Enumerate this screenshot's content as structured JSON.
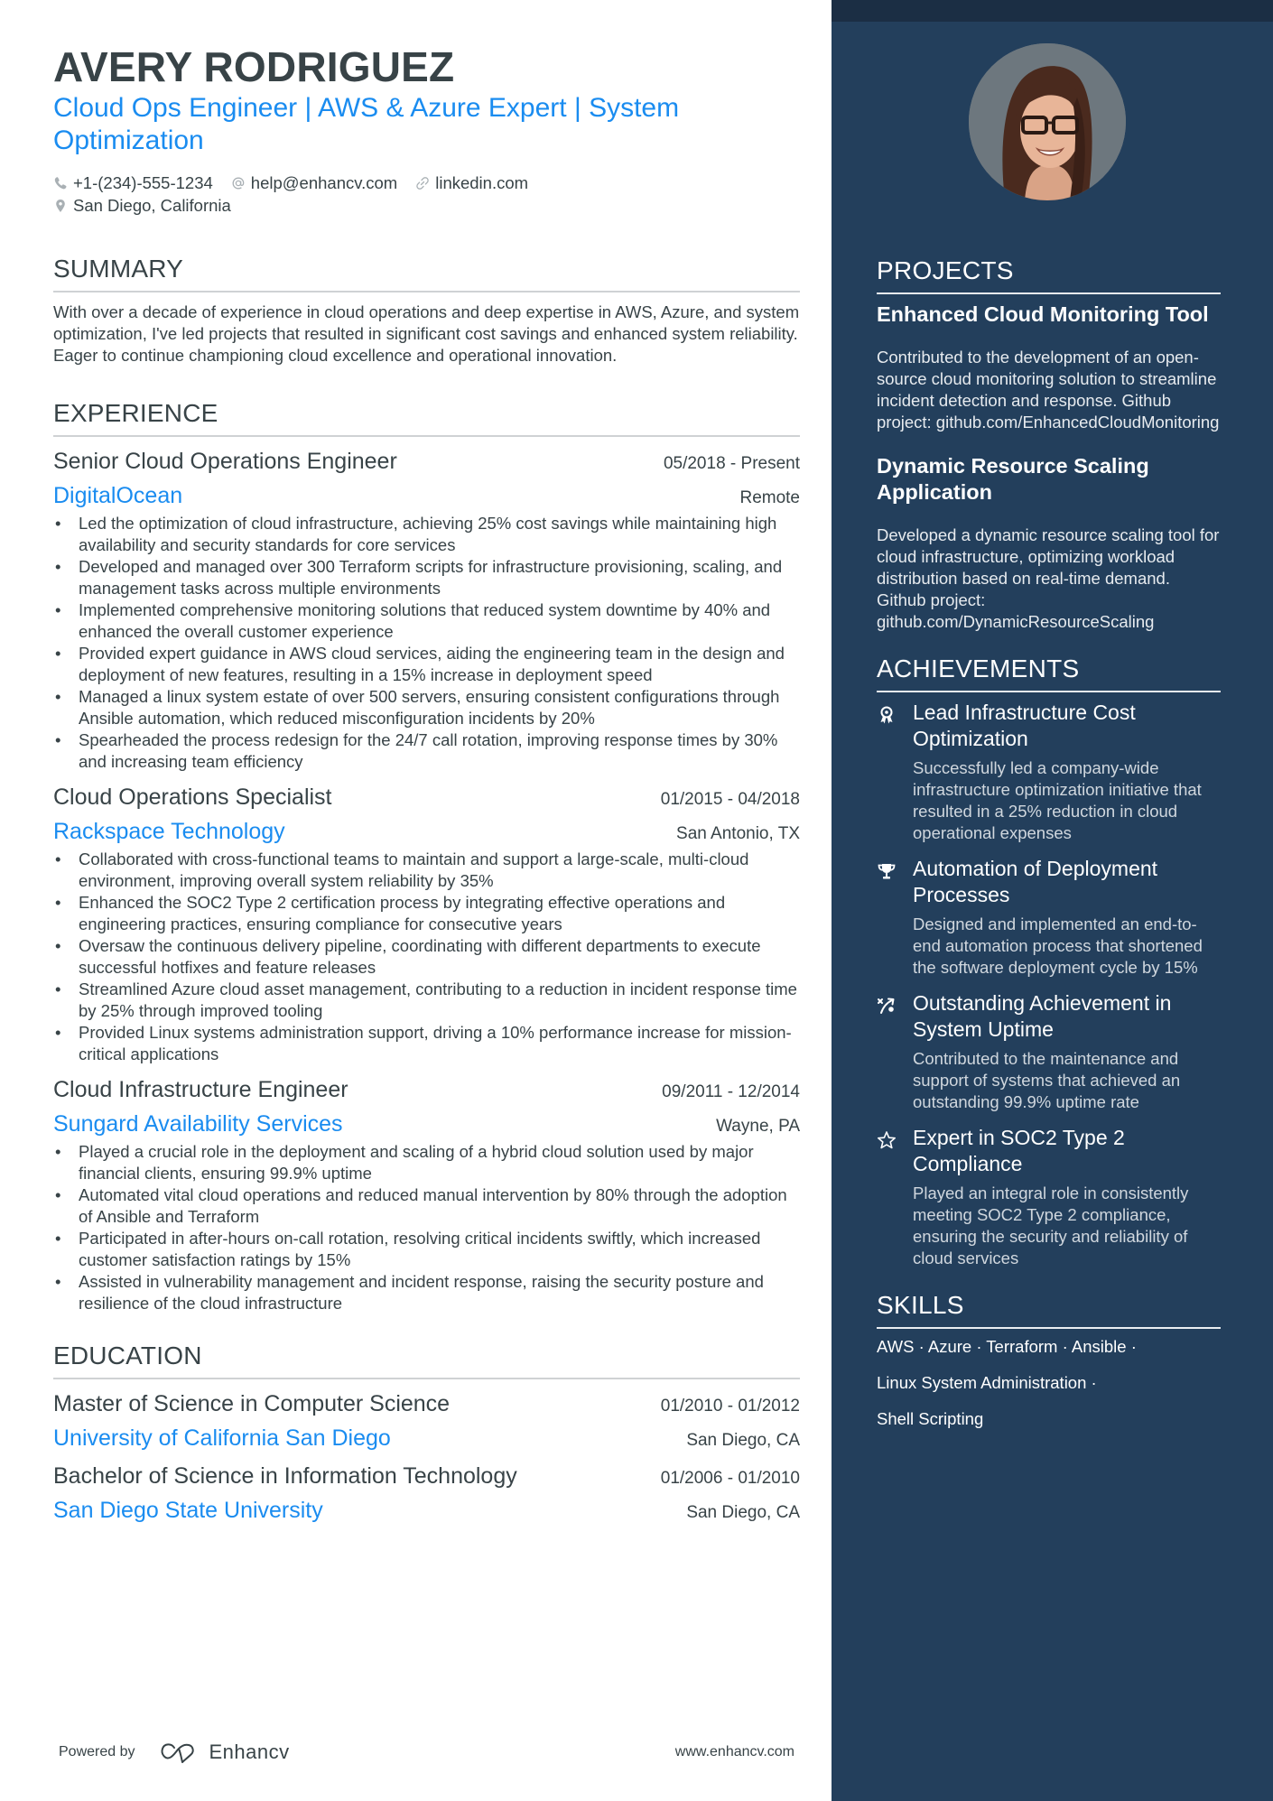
{
  "header": {
    "name": "AVERY RODRIGUEZ",
    "headline": "Cloud Ops Engineer | AWS & Azure Expert | System Optimization",
    "contacts": {
      "phone": "+1-(234)-555-1234",
      "email": "help@enhancv.com",
      "link": "linkedin.com",
      "location": "San Diego, California"
    }
  },
  "summary": {
    "title": "SUMMARY",
    "text": "With over a decade of experience in cloud operations and deep expertise in AWS, Azure, and system optimization, I've led projects that resulted in significant cost savings and enhanced system reliability. Eager to continue championing cloud excellence and operational innovation."
  },
  "experience": {
    "title": "EXPERIENCE",
    "jobs": [
      {
        "title": "Senior Cloud Operations Engineer",
        "dates": "05/2018 - Present",
        "company": "DigitalOcean",
        "location": "Remote",
        "bullets": [
          "Led the optimization of cloud infrastructure, achieving 25% cost savings while maintaining high availability and security standards for core services",
          "Developed and managed over 300 Terraform scripts for infrastructure provisioning, scaling, and management tasks across multiple environments",
          "Implemented comprehensive monitoring solutions that reduced system downtime by 40% and enhanced the overall customer experience",
          "Provided expert guidance in AWS cloud services, aiding the engineering team in the design and deployment of new features, resulting in a 15% increase in deployment speed",
          "Managed a linux system estate of over 500 servers, ensuring consistent configurations through Ansible automation, which reduced misconfiguration incidents by 20%",
          "Spearheaded the process redesign for the 24/7 call rotation, improving response times by 30% and increasing team efficiency"
        ]
      },
      {
        "title": "Cloud Operations Specialist",
        "dates": "01/2015 - 04/2018",
        "company": "Rackspace Technology",
        "location": "San Antonio, TX",
        "bullets": [
          "Collaborated with cross-functional teams to maintain and support a large-scale, multi-cloud environment, improving overall system reliability by 35%",
          "Enhanced the SOC2 Type 2 certification process by integrating effective operations and engineering practices, ensuring compliance for consecutive years",
          "Oversaw the continuous delivery pipeline, coordinating with different departments to execute successful hotfixes and feature releases",
          "Streamlined Azure cloud asset management, contributing to a reduction in incident response time by 25% through improved tooling",
          "Provided Linux systems administration support, driving a 10% performance increase for mission-critical applications"
        ]
      },
      {
        "title": "Cloud Infrastructure Engineer",
        "dates": "09/2011 - 12/2014",
        "company": "Sungard Availability Services",
        "location": "Wayne, PA",
        "bullets": [
          "Played a crucial role in the deployment and scaling of a hybrid cloud solution used by major financial clients, ensuring 99.9% uptime",
          "Automated vital cloud operations and reduced manual intervention by 80% through the adoption of Ansible and Terraform",
          "Participated in after-hours on-call rotation, resolving critical incidents swiftly, which increased customer satisfaction ratings by 15%",
          "Assisted in vulnerability management and incident response, raising the security posture and resilience of the cloud infrastructure"
        ]
      }
    ]
  },
  "education": {
    "title": "EDUCATION",
    "items": [
      {
        "degree": "Master of Science in Computer Science",
        "dates": "01/2010 - 01/2012",
        "school": "University of California San Diego",
        "location": "San Diego, CA"
      },
      {
        "degree": "Bachelor of Science in Information Technology",
        "dates": "01/2006 - 01/2010",
        "school": "San Diego State University",
        "location": "San Diego, CA"
      }
    ]
  },
  "projects": {
    "title": "PROJECTS",
    "items": [
      {
        "title": "Enhanced Cloud Monitoring Tool",
        "description": "Contributed to the development of an open-source cloud monitoring solution to streamline incident detection and response. Github project: github.com/EnhancedCloudMonitoring"
      },
      {
        "title": "Dynamic Resource Scaling Application",
        "description": "Developed a dynamic resource scaling tool for cloud infrastructure, optimizing workload distribution based on real-time demand. Github project: github.com/DynamicResourceScaling"
      }
    ]
  },
  "achievements": {
    "title": "ACHIEVEMENTS",
    "items": [
      {
        "icon": "award-ribbon-icon",
        "title": "Lead Infrastructure Cost Optimization",
        "description": "Successfully led a company-wide infrastructure optimization initiative that resulted in a 25% reduction in cloud operational expenses"
      },
      {
        "icon": "trophy-icon",
        "title": "Automation of Deployment Processes",
        "description": "Designed and implemented an end-to-end automation process that shortened the software deployment cycle by 15%"
      },
      {
        "icon": "strategy-arrow-icon",
        "title": "Outstanding Achievement in System Uptime",
        "description": "Contributed to the maintenance and support of systems that achieved an outstanding 99.9% uptime rate"
      },
      {
        "icon": "star-outline-icon",
        "title": "Expert in SOC2 Type 2 Compliance",
        "description": "Played an integral role in consistently meeting SOC2 Type 2 compliance, ensuring the security and reliability of cloud services"
      }
    ]
  },
  "skills": {
    "title": "SKILLS",
    "lines": [
      "AWS · Azure · Terraform · Ansible ·",
      "Linux System Administration ·",
      "Shell Scripting"
    ]
  },
  "footer": {
    "powered_by": "Powered by",
    "brand": "Enhancv",
    "website": "www.enhancv.com"
  },
  "colors": {
    "accent": "#1a8cf0",
    "text": "#384347",
    "sidebar_bg": "#233f5c",
    "sidebar_top": "#1b2e44"
  }
}
